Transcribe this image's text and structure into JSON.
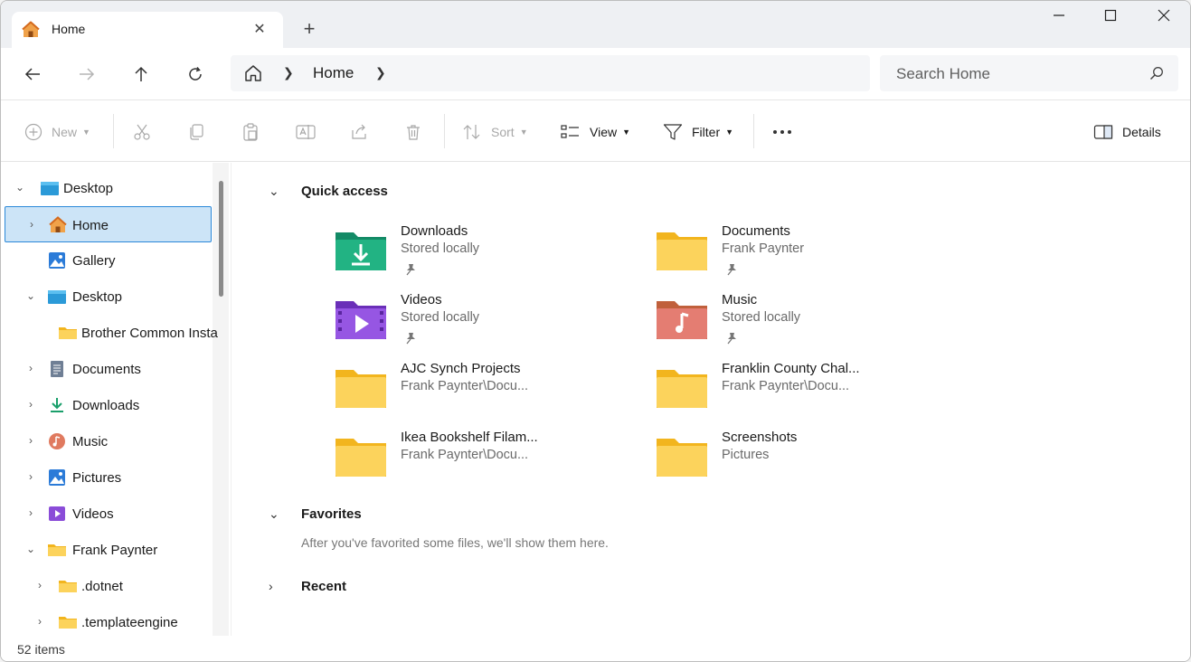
{
  "window": {
    "tab_title": "Home",
    "new_tab_symbol": "+",
    "controls": [
      "minimize-icon",
      "maximize-icon",
      "close-icon"
    ]
  },
  "navigation": {
    "address_segments": [
      "Home"
    ],
    "search_placeholder": "Search Home"
  },
  "toolbar": {
    "new_label": "New",
    "sort_label": "Sort",
    "view_label": "View",
    "filter_label": "Filter",
    "details_label": "Details"
  },
  "sidebar": {
    "items": [
      {
        "label": "Desktop",
        "icon": "desktop-icon",
        "expanded": true
      },
      {
        "label": "Home",
        "icon": "home-icon",
        "selected": true
      },
      {
        "label": "Gallery",
        "icon": "gallery-icon"
      },
      {
        "label": "Desktop",
        "icon": "desktop-icon",
        "expanded": true
      },
      {
        "label": "Brother Common Insta",
        "icon": "folder-icon"
      },
      {
        "label": "Documents",
        "icon": "documents-icon"
      },
      {
        "label": "Downloads",
        "icon": "downloads-icon"
      },
      {
        "label": "Music",
        "icon": "music-icon"
      },
      {
        "label": "Pictures",
        "icon": "pictures-icon"
      },
      {
        "label": "Videos",
        "icon": "videos-icon"
      },
      {
        "label": "Frank Paynter",
        "icon": "folder-icon",
        "expanded": true
      },
      {
        "label": ".dotnet",
        "icon": "folder-icon"
      },
      {
        "label": ".templateengine",
        "icon": "folder-icon"
      }
    ]
  },
  "main": {
    "quick_access_title": "Quick access",
    "quick_access": [
      {
        "name": "Downloads",
        "sub": "Stored locally",
        "icon": "downloads-folder-icon",
        "pinned": true
      },
      {
        "name": "Documents",
        "sub": "Frank Paynter",
        "icon": "folder-icon",
        "pinned": true
      },
      {
        "name": "Videos",
        "sub": "Stored locally",
        "icon": "videos-folder-icon",
        "pinned": true
      },
      {
        "name": "Music",
        "sub": "Stored locally",
        "icon": "music-folder-icon",
        "pinned": true
      },
      {
        "name": "AJC Synch Projects",
        "sub": "Frank Paynter\\Docu...",
        "icon": "folder-icon",
        "pinned": false
      },
      {
        "name": "Franklin County Chal...",
        "sub": "Frank Paynter\\Docu...",
        "icon": "folder-icon",
        "pinned": false
      },
      {
        "name": "Ikea Bookshelf Filam...",
        "sub": "Frank Paynter\\Docu...",
        "icon": "folder-icon",
        "pinned": false
      },
      {
        "name": "Screenshots",
        "sub": "Pictures",
        "icon": "folder-icon",
        "pinned": false
      }
    ],
    "favorites_title": "Favorites",
    "favorites_empty": "After you've favorited some files, we'll show them here.",
    "recent_title": "Recent"
  },
  "status": {
    "items_count": "52 items"
  },
  "colors": {
    "accent": "#0067c0",
    "selection_bg": "#cce4f7",
    "folder_yellow": "#f7c948"
  }
}
